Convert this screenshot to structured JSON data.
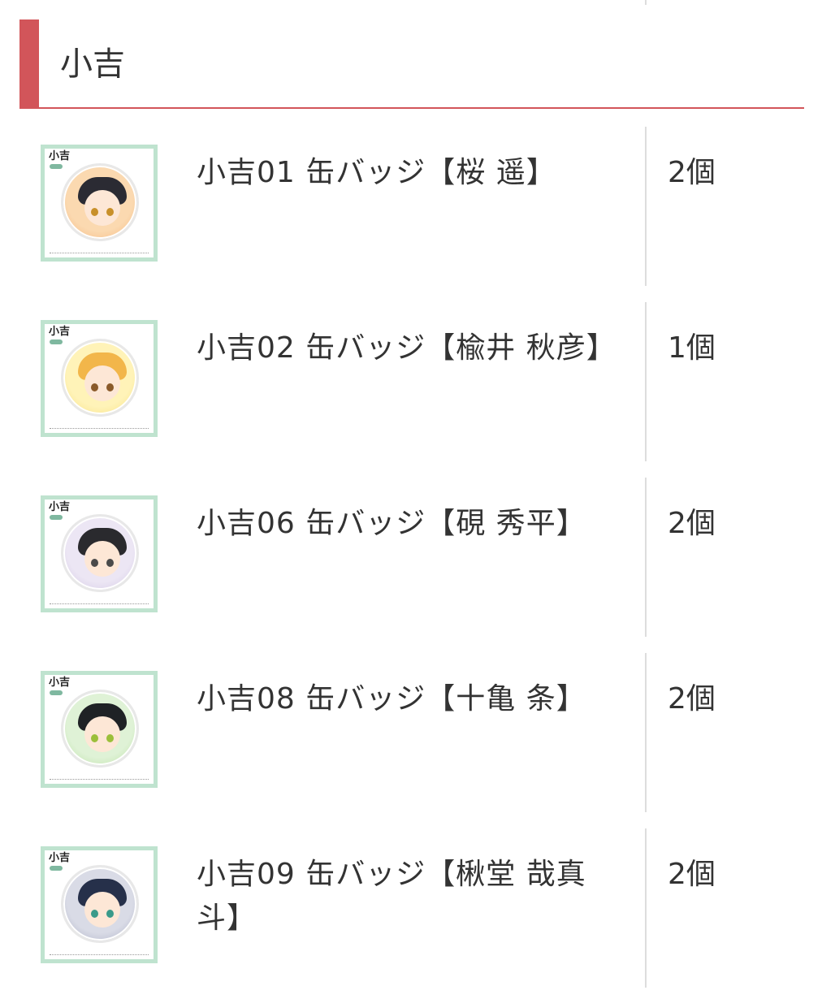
{
  "section": {
    "title": "小吉"
  },
  "thumb_logo": "小吉",
  "items": [
    {
      "name": "小吉01 缶バッジ【桜 遥】",
      "qty": "2個",
      "colors": {
        "bg": "#fbd9b0",
        "hair": "#2b2b33",
        "eye": "#c8902a",
        "ring": "#f4b57a"
      }
    },
    {
      "name": "小吉02 缶バッジ【楡井 秋彦】",
      "qty": "1個",
      "colors": {
        "bg": "#fff3b8",
        "hair": "#f2b64a",
        "eye": "#8a5a2a",
        "ring": "#f6df7a"
      }
    },
    {
      "name": "小吉06 缶バッジ【硯 秀平】",
      "qty": "2個",
      "colors": {
        "bg": "#ece6f4",
        "hair": "#2a2a2e",
        "eye": "#4a4a4a",
        "ring": "#cfc3e2"
      }
    },
    {
      "name": "小吉08 缶バッジ【十亀 条】",
      "qty": "2個",
      "colors": {
        "bg": "#dff2d6",
        "hair": "#1f2225",
        "eye": "#9bbf3a",
        "ring": "#b7df9f"
      }
    },
    {
      "name": "小吉09 缶バッジ【楸堂 哉真斗】",
      "qty": "2個",
      "colors": {
        "bg": "#d9dbe6",
        "hair": "#26304a",
        "eye": "#3a9a8a",
        "ring": "#a7abc2"
      }
    }
  ]
}
